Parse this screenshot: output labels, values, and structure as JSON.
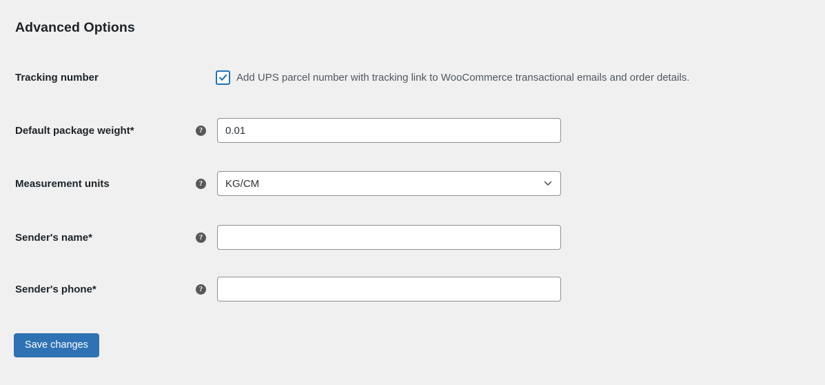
{
  "page": {
    "title": "Advanced Options",
    "background_color": "#f0f0f1",
    "accent_color": "#2271b1"
  },
  "fields": {
    "tracking": {
      "label": "Tracking number",
      "checkbox_label": "Add UPS parcel number with tracking link to WooCommerce transactional emails and order details.",
      "checked": "true"
    },
    "weight": {
      "label": "Default package weight*",
      "value": "0.01",
      "placeholder": "",
      "help": "?"
    },
    "units": {
      "label": "Measurement units",
      "value": "KG/CM",
      "options": [
        "KG/CM"
      ],
      "help": "?"
    },
    "sender_name": {
      "label": "Sender's name*",
      "value": "",
      "placeholder": "",
      "help": "?"
    },
    "sender_phone": {
      "label": "Sender's phone*",
      "value": "",
      "placeholder": "",
      "help": "?"
    }
  },
  "actions": {
    "save_label": "Save changes"
  }
}
